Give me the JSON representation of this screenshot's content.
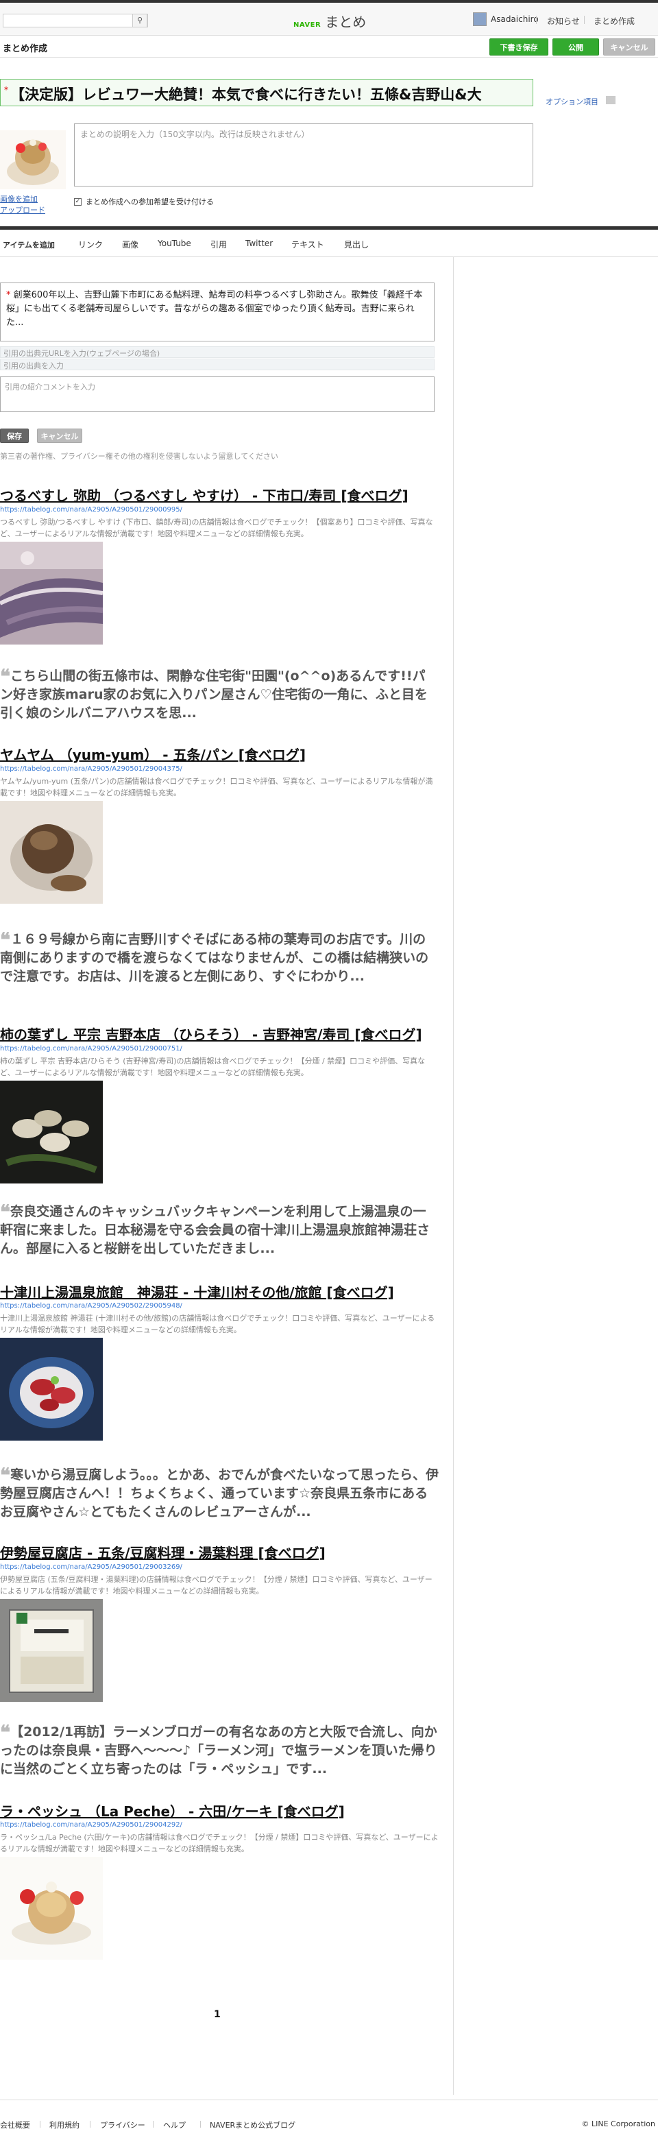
{
  "header": {
    "brand": "NAVER",
    "logo": "まとめ",
    "username": "Asadaichiro",
    "nav": [
      "お知らせ",
      "まとめ作成"
    ]
  },
  "subheader": {
    "title": "まとめ作成",
    "buttons": {
      "draft": "下書き保存",
      "publish": "公開",
      "cancel": "キャンセル"
    }
  },
  "editor": {
    "title": "【決定版】レビュワー大絶賛！本気で食べに行きたい！五條&吉野山&大",
    "option_link": "オプション項目",
    "description_placeholder": "まとめの説明を入力（150文字以内。改行は反映されません）",
    "change_thumb": [
      "画像を追加",
      "アップロード"
    ],
    "checkbox_label": "まとめ作成への参加希望を受け付ける"
  },
  "tabs": [
    "アイテムを追加",
    "リンク",
    "画像",
    "YouTube",
    "引用",
    "Twitter",
    "テキスト",
    "見出し"
  ],
  "cite_form": {
    "text": "創業600年以上、吉野山麓下市町にある鮎料理、鮎寿司の料亭つるべすし弥助さん。歌舞伎「義経千本桜」にも出てくる老舗寿司屋らしいです。昔ながらの趣ある個室でゆったり頂く鮎寿司。吉野に来られた...",
    "url_placeholder": "引用の出典元URLを入力(ウェブページの場合)",
    "source_placeholder": "引用の出典を入力",
    "comment_placeholder": "引用の紹介コメントを入力",
    "save": "保存",
    "cancel": "キャンセル",
    "notice": "第三者の著作権、プライバシー権その他の権利を侵害しないよう留意してください"
  },
  "items": [
    {
      "type": "link",
      "title": "つるべすし 弥助 （つるべすし やすけ） - 下市口/寿司 [食べログ]",
      "url": "https://tabelog.com/nara/A2905/A290501/29000995/",
      "desc": "つるべすし 弥助/つるべすし やすけ (下市口、鎮郎/寿司)の店舗情報は食べログでチェック！【個室あり】口コミや評価、写真など、ユーザーによるリアルな情報が満載です！地図や料理メニューなどの詳細情報も充実。",
      "image": "sushi-photo"
    },
    {
      "type": "quote",
      "text": "こちら山間の街五條市は、閑静な住宅街\"田園\"(o^^o)あるんです!!パン好き家族maru家のお気に入りパン屋さん♡住宅街の一角に、ふと目を引く娘のシルバニアハウスを思..."
    },
    {
      "type": "link",
      "title": "ヤムヤム （yum-yum） - 五条/パン [食べログ]",
      "url": "https://tabelog.com/nara/A2905/A290501/29004375/",
      "desc": "ヤムヤム/yum-yum (五条/パン)の店舗情報は食べログでチェック！口コミや評価、写真など、ユーザーによるリアルな情報が満載です！地図や料理メニューなどの詳細情報も充実。",
      "image": "bread-photo"
    },
    {
      "type": "quote",
      "text": "１６９号線から南に吉野川すぐそばにある柿の葉寿司のお店です。川の南側にありますので橋を渡らなくてはなりませんが、この橋は結構狭いので注意です。お店は、川を渡ると左側にあり、すぐにわかり..."
    },
    {
      "type": "link",
      "title": "柿の葉ずし 平宗 吉野本店 （ひらそう） - 吉野神宮/寿司 [食べログ]",
      "url": "https://tabelog.com/nara/A2905/A290501/29000751/",
      "desc": "柿の葉ずし 平宗 吉野本店/ひらそう (吉野神宮/寿司)の店舗情報は食べログでチェック！【分煙 / 禁煙】口コミや評価、写真など、ユーザーによるリアルな情報が満載です！地図や料理メニューなどの詳細情報も充実。",
      "image": "kakinoha-photo"
    },
    {
      "type": "quote",
      "text": "奈良交通さんのキャッシュバックキャンペーンを利用して上湯温泉の一軒宿に来ました。日本秘湯を守る会会員の宿十津川上湯温泉旅館神湯荘さん。部屋に入ると桜餅を出していただきまし..."
    },
    {
      "type": "link",
      "title": "十津川上湯温泉旅館　神湯荘 - 十津川村その他/旅館 [食べログ]",
      "url": "https://tabelog.com/nara/A2905/A290502/29005948/",
      "desc": "十津川上湯温泉旅館 神湯荘 (十津川村その他/旅館)の店舗情報は食べログでチェック！口コミや評価、写真など、ユーザーによるリアルな情報が満載です！地図や料理メニューなどの詳細情報も充実。",
      "image": "sashimi-photo"
    },
    {
      "type": "quote",
      "text": "寒いから湯豆腐しよう。。。とかあ、おでんが食べたいなって思ったら、伊勢屋豆腐店さんへ！！ちょくちょく、通っています☆奈良県五条市にあるお豆腐やさん☆とてもたくさんのレビュアーさんが..."
    },
    {
      "type": "link",
      "title": "伊勢屋豆腐店 - 五条/豆腐料理・湯葉料理 [食べログ]",
      "url": "https://tabelog.com/nara/A2905/A290501/29003269/",
      "desc": "伊勢屋豆腐店 (五条/豆腐料理・湯葉料理)の店舗情報は食べログでチェック！【分煙 / 禁煙】口コミや評価、写真など、ユーザーによるリアルな情報が満載です！地図や料理メニューなどの詳細情報も充実。",
      "image": "tofu-photo"
    },
    {
      "type": "quote",
      "text": "【2012/1再訪】ラーメンブロガーの有名なあの方と大阪で合流し、向かったのは奈良県・吉野へ〜〜〜♪「ラーメン河」で塩ラーメンを頂いた帰りに当然のごとく立ち寄ったのは「ラ・ペッシュ」です..."
    },
    {
      "type": "link",
      "title": "ラ・ペッシュ （La Peche） - 六田/ケーキ [食べログ]",
      "url": "https://tabelog.com/nara/A2905/A290501/29004292/",
      "desc": "ラ・ペッシュ/La Peche (六田/ケーキ)の店舗情報は食べログでチェック！【分煙 / 禁煙】口コミや評価、写真など、ユーザーによるリアルな情報が満載です！地図や料理メニューなどの詳細情報も充実。",
      "image": "cake-photo"
    }
  ],
  "pager": {
    "current": "1"
  },
  "footer": {
    "links": [
      "会社概要",
      "利用規約",
      "プライバシー",
      "ヘルプ",
      "NAVERまとめ公式ブログ"
    ],
    "copyright": "© LINE Corporation"
  }
}
